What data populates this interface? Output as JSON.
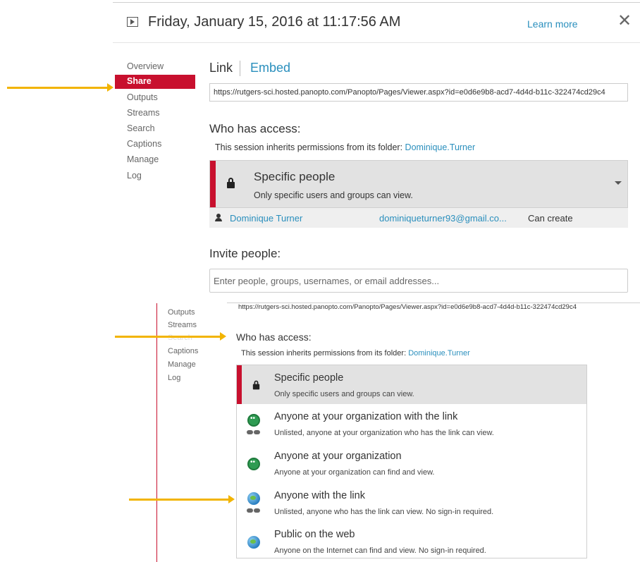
{
  "header": {
    "title": "Friday, January 15, 2016 at 11:17:56 AM",
    "learn_more": "Learn more",
    "close_glyph": "✕"
  },
  "nav": {
    "items": [
      "Overview",
      "Share",
      "Outputs",
      "Streams",
      "Search",
      "Captions",
      "Manage",
      "Log"
    ]
  },
  "share": {
    "tab_link": "Link",
    "tab_embed": "Embed",
    "url": "https://rutgers-sci.hosted.panopto.com/Panopto/Pages/Viewer.aspx?id=e0d6e9b8-acd7-4d4d-b11c-322474cd29c4",
    "who_has_access": "Who has access:",
    "inherit_prefix": "This session inherits permissions from its folder:",
    "folder_name": "Dominique.Turner",
    "access_title": "Specific people",
    "access_desc": "Only specific users and groups can view.",
    "user_name": "Dominique Turner",
    "user_email": "dominiqueturner93@gmail.co...",
    "user_role": "Can create",
    "invite_title": "Invite people:",
    "invite_placeholder": "Enter people, groups, usernames, or email addresses..."
  },
  "zoom": {
    "nav": [
      "Outputs",
      "Streams",
      "Search",
      "Captions",
      "Manage",
      "Log"
    ],
    "url": "https://rutgers-sci.hosted.panopto.com/Panopto/Pages/Viewer.aspx?id=e0d6e9b8-acd7-4d4d-b11c-322474cd29c4",
    "who_has_access": "Who has access:",
    "inherit_prefix": "This session inherits permissions from its folder:",
    "folder_name": "Dominique.Turner",
    "options": [
      {
        "title": "Specific people",
        "desc": "Only specific users and groups can view.",
        "icon": "lock-icon"
      },
      {
        "title": "Anyone at your organization with the link",
        "desc": "Unlisted, anyone at your organization who has the link can view.",
        "icon": "group-link-icon"
      },
      {
        "title": "Anyone at your organization",
        "desc": "Anyone at your organization can find and view.",
        "icon": "group-icon"
      },
      {
        "title": "Anyone with the link",
        "desc": "Unlisted, anyone who has the link can view. No sign-in required.",
        "icon": "globe-link-icon"
      },
      {
        "title": "Public on the web",
        "desc": "Anyone on the Internet can find and view. No sign-in required.",
        "icon": "globe-icon"
      }
    ]
  },
  "colors": {
    "accent_red": "#c8102e",
    "link_blue": "#2a8fbd",
    "arrow_yellow": "#f2b400"
  }
}
